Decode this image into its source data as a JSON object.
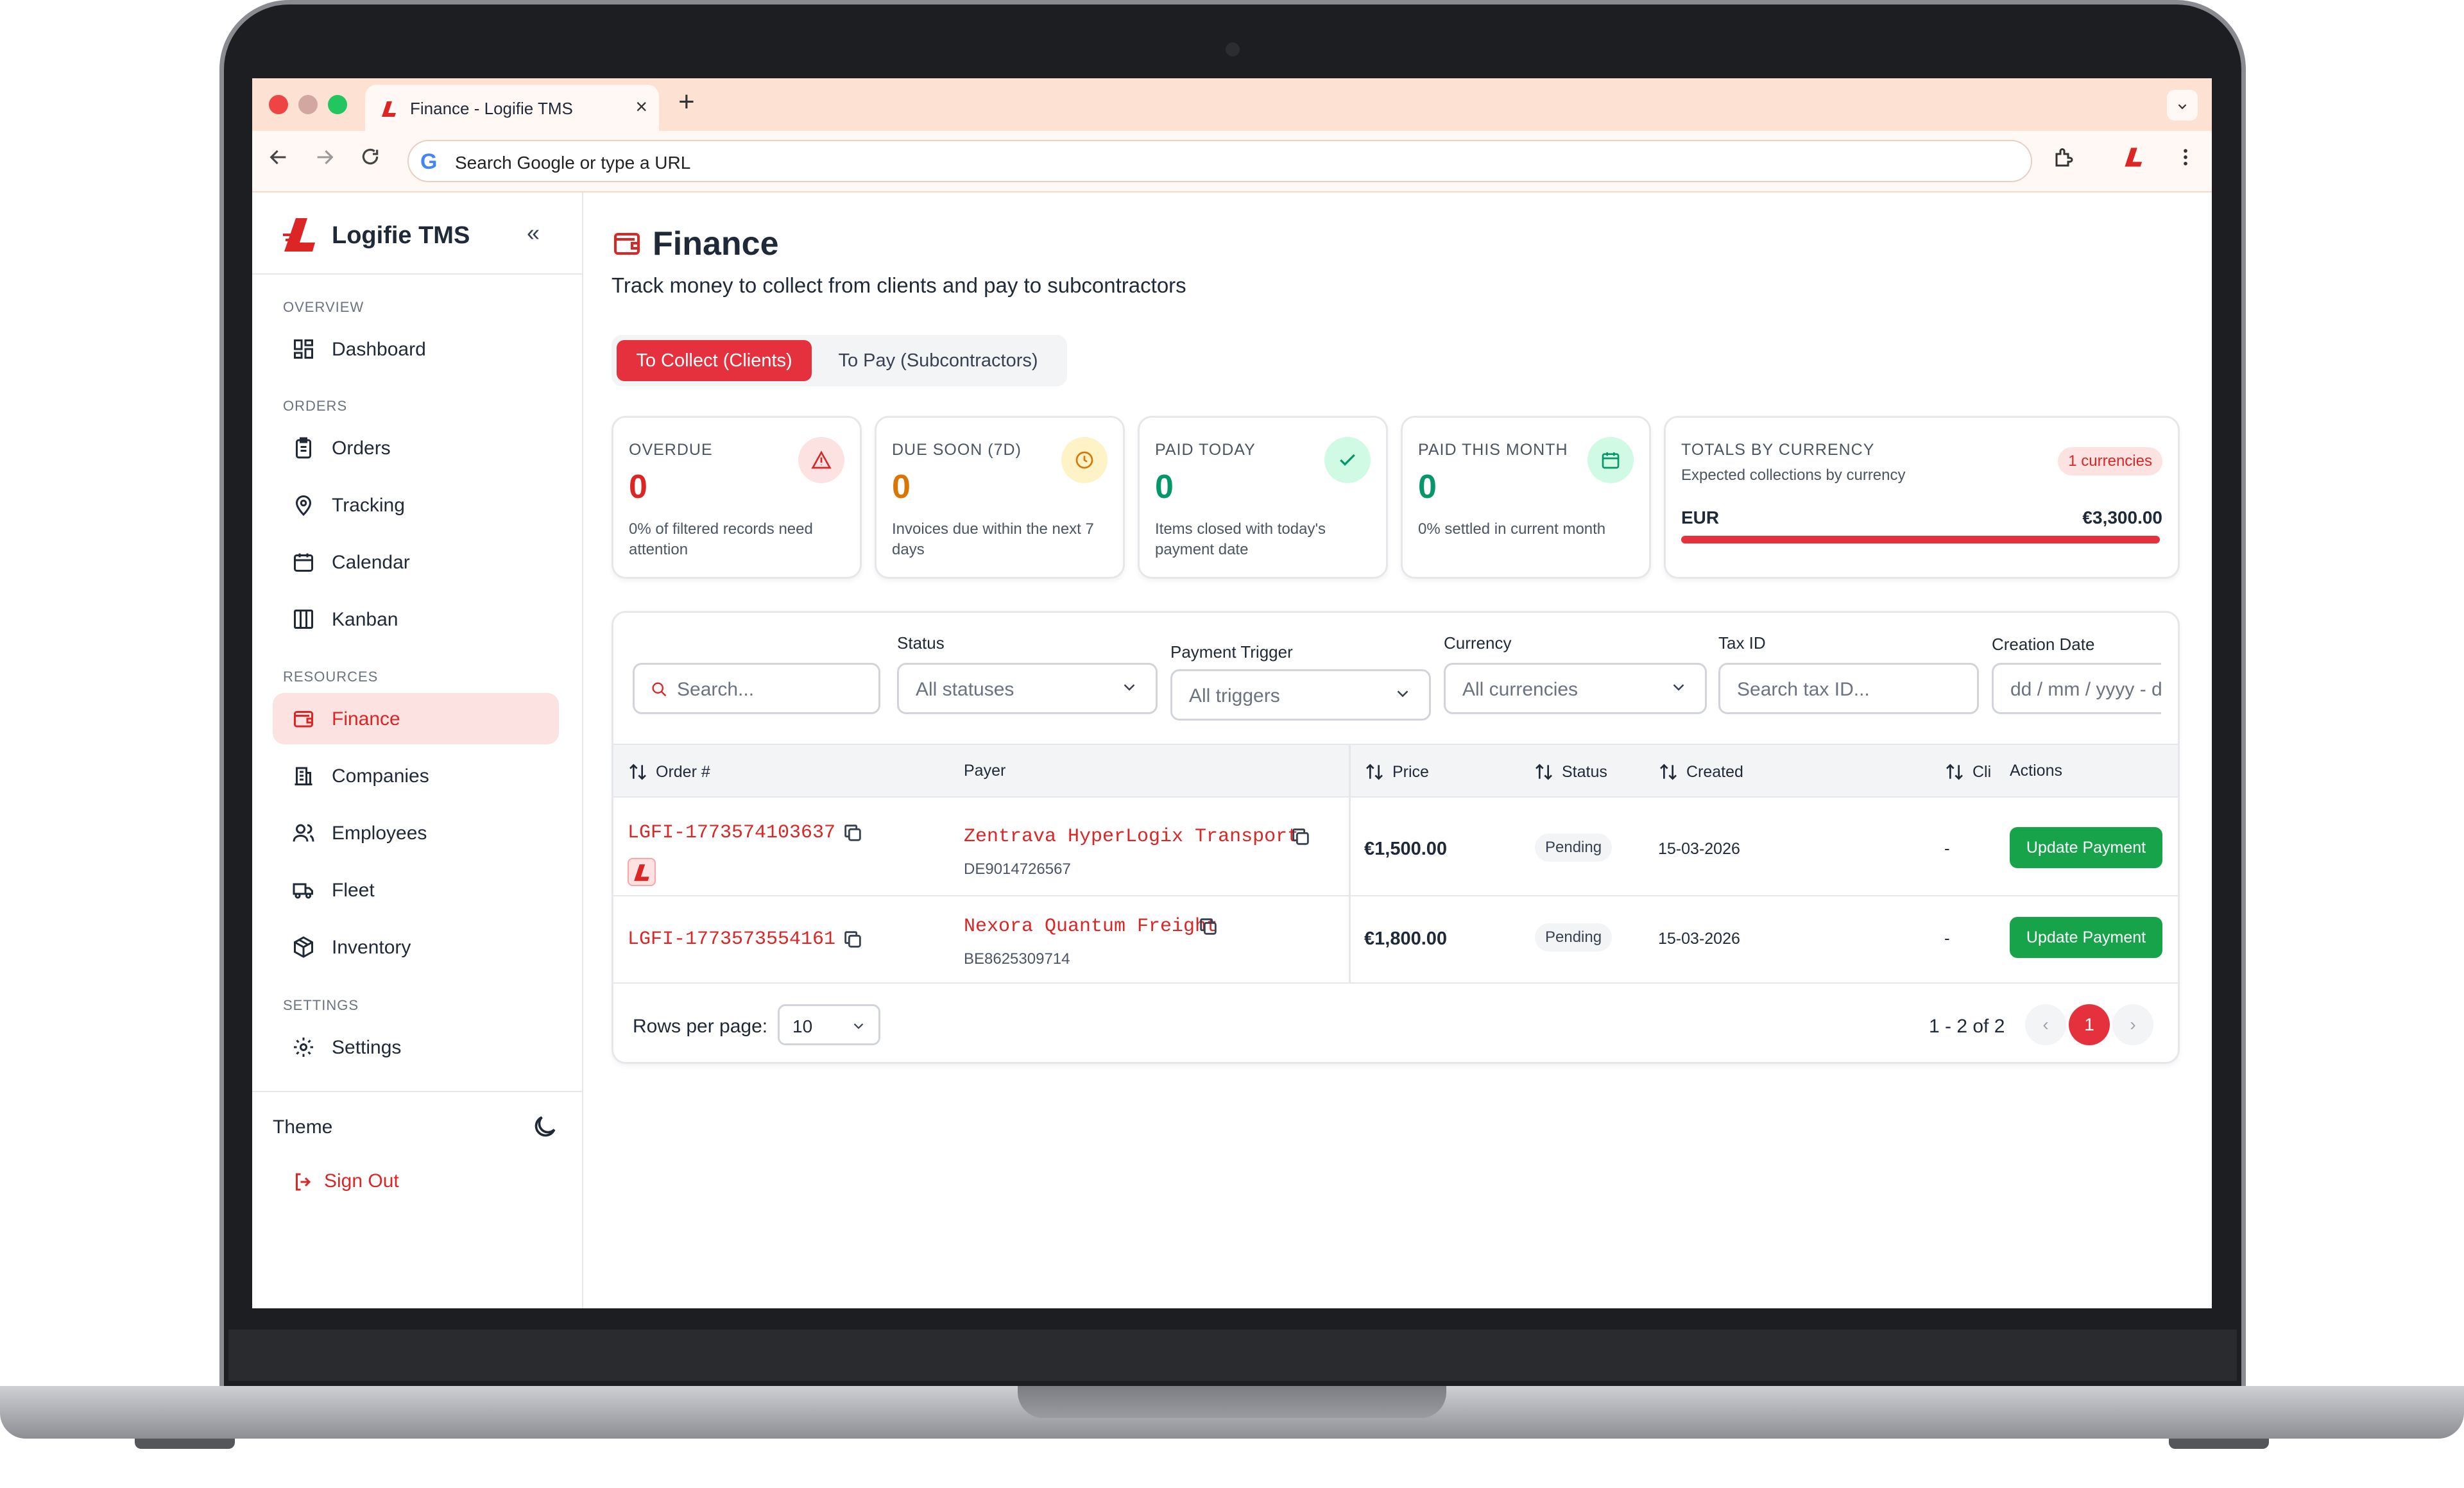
{
  "browser": {
    "tab_title": "Finance - Logifie TMS",
    "tab_close": "×",
    "new_tab": "+",
    "omnibox_placeholder": "Search Google or type a URL",
    "google_letter": "G"
  },
  "sidebar": {
    "brand": "Logifie TMS",
    "collapse_glyph": "«",
    "sections": {
      "overview": "OVERVIEW",
      "orders": "ORDERS",
      "resources": "RESOURCES",
      "settings": "SETTINGS"
    },
    "items": {
      "dashboard": "Dashboard",
      "orders": "Orders",
      "tracking": "Tracking",
      "calendar": "Calendar",
      "kanban": "Kanban",
      "finance": "Finance",
      "companies": "Companies",
      "employees": "Employees",
      "fleet": "Fleet",
      "inventory": "Inventory",
      "settings": "Settings"
    },
    "theme_label": "Theme",
    "sign_out": "Sign Out"
  },
  "page": {
    "title": "Finance",
    "subtitle": "Track money to collect from clients and pay to subcontractors",
    "tabs": {
      "collect": "To Collect (Clients)",
      "pay": "To Pay (Subcontractors)"
    }
  },
  "cards": {
    "overdue": {
      "label": "OVERDUE",
      "value": "0",
      "desc": "0% of filtered records need attention",
      "color": "#dc2626"
    },
    "due_soon": {
      "label": "DUE SOON (7D)",
      "value": "0",
      "desc": "Invoices due within the next 7 days",
      "color": "#d97706"
    },
    "paid_today": {
      "label": "PAID TODAY",
      "value": "0",
      "desc": "Items closed with today's payment date",
      "color": "#059669"
    },
    "paid_month": {
      "label": "PAID THIS MONTH",
      "value": "0",
      "desc": "0% settled in current month",
      "color": "#059669"
    },
    "totals": {
      "label": "TOTALS BY CURRENCY",
      "sub": "Expected collections by currency",
      "pill": "1 currencies",
      "currency": "EUR",
      "amount": "€3,300.00"
    }
  },
  "filters": {
    "search_placeholder": "Search...",
    "status_label": "Status",
    "status_value": "All statuses",
    "trigger_label": "Payment Trigger",
    "trigger_value": "All triggers",
    "currency_label": "Currency",
    "currency_value": "All currencies",
    "taxid_label": "Tax ID",
    "taxid_placeholder": "Search tax ID...",
    "date_label": "Creation Date",
    "date_placeholder": "dd / mm / yyyy  - d"
  },
  "table": {
    "headers": {
      "order": "Order #",
      "payer": "Payer",
      "price": "Price",
      "status": "Status",
      "created": "Created",
      "cli": "Cli",
      "actions": "Actions"
    },
    "rows": [
      {
        "order": "LGFI-1773574103637",
        "payer": "Zentrava HyperLogix Transport",
        "tax_id": "DE9014726567",
        "price": "€1,500.00",
        "status": "Pending",
        "created": "15-03-2026",
        "cli": "-",
        "action": "Update Payment"
      },
      {
        "order": "LGFI-1773573554161",
        "payer": "Nexora Quantum Freight",
        "tax_id": "BE8625309714",
        "price": "€1,800.00",
        "status": "Pending",
        "created": "15-03-2026",
        "cli": "-",
        "action": "Update Payment"
      }
    ]
  },
  "pagination": {
    "rows_per_page_label": "Rows per page:",
    "rows_per_page": "10",
    "range": "1 - 2 of 2",
    "prev": "‹",
    "page": "1",
    "next": "›"
  },
  "colors": {
    "accent": "#e5313d",
    "success": "#16a34a",
    "warning": "#d97706"
  }
}
